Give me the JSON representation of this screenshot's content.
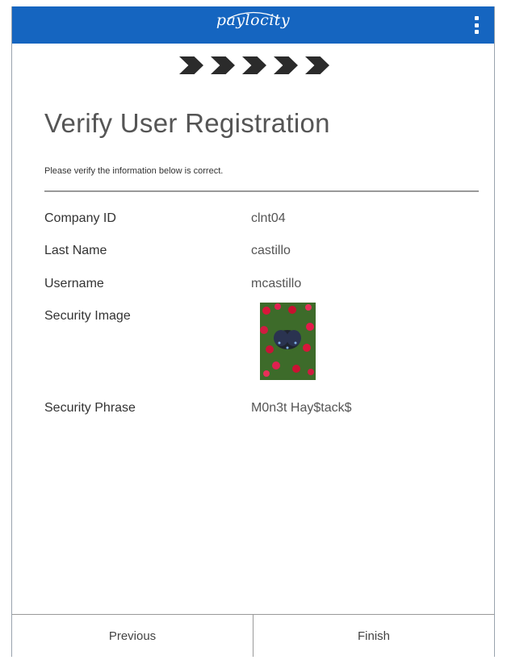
{
  "header": {
    "logo_text": "paylocity",
    "menu_icon": "kebab-menu-icon",
    "background_color": "#1565c0"
  },
  "progress": {
    "steps_total": 5,
    "icon": "chevron-right-icon"
  },
  "page": {
    "title": "Verify User Registration",
    "subtitle": "Please verify the information below is correct."
  },
  "fields": {
    "company_id": {
      "label": "Company ID",
      "value": "clnt04"
    },
    "last_name": {
      "label": "Last Name",
      "value": "castillo"
    },
    "username": {
      "label": "Username",
      "value": "mcastillo"
    },
    "security_image": {
      "label": "Security Image"
    },
    "security_phrase": {
      "label": "Security Phrase",
      "value": "M0n3t Hay$tack$"
    }
  },
  "footer": {
    "previous_label": "Previous",
    "finish_label": "Finish"
  }
}
